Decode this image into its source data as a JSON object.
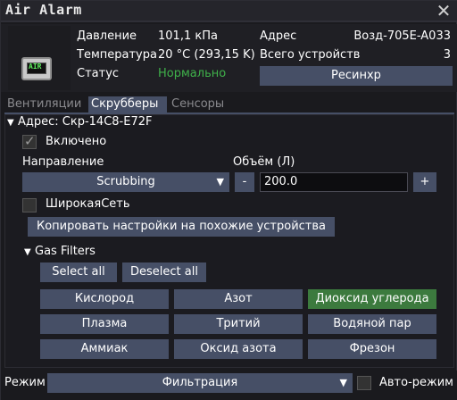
{
  "window": {
    "title": "Air Alarm"
  },
  "header": {
    "pressure_label": "Давление",
    "pressure_value": "101,1 кПа",
    "temperature_label": "Температура",
    "temperature_value": "20 °C (293,15 K)",
    "status_label": "Статус",
    "status_value": "Нормально",
    "address_label": "Адрес",
    "address_value": "Возд-705E-A033",
    "devices_label": "Всего устройств",
    "devices_value": "3",
    "resync_label": "Ресинхр",
    "icon_text": "AIR",
    "status_color": "#3fb14a"
  },
  "tabs": [
    {
      "label": "Вентиляции",
      "active": false
    },
    {
      "label": "Скрубберы",
      "active": true
    },
    {
      "label": "Сенсоры",
      "active": false
    }
  ],
  "scrubber": {
    "address_label": "Адрес: Скр-14C8-E72F",
    "enabled_label": "Включено",
    "enabled": true,
    "direction_label": "Направление",
    "direction_value": "Scrubbing",
    "volume_label": "Объём (Л)",
    "volume_minus": "-",
    "volume_value": "200.0",
    "volume_plus": "+",
    "widenet_label": "ШирокаяСеть",
    "widenet": false,
    "copy_label": "Копировать настройки на похожие устройства",
    "gas_filters_label": "Gas Filters",
    "select_all": "Select all",
    "deselect_all": "Deselect all",
    "gases": [
      {
        "label": "Кислород",
        "active": false
      },
      {
        "label": "Азот",
        "active": false
      },
      {
        "label": "Диоксид углерода",
        "active": true
      },
      {
        "label": "Плазма",
        "active": false
      },
      {
        "label": "Тритий",
        "active": false
      },
      {
        "label": "Водяной пар",
        "active": false
      },
      {
        "label": "Аммиак",
        "active": false
      },
      {
        "label": "Оксид азота",
        "active": false
      },
      {
        "label": "Фрезон",
        "active": false
      }
    ]
  },
  "footer": {
    "mode_label": "Режим",
    "mode_value": "Фильтрация",
    "auto_label": "Авто-режим",
    "auto": false
  },
  "colors": {
    "button": "#464f66",
    "active_gas": "#3c7a3e",
    "ok_text": "#3fb14a"
  },
  "icons": {
    "close": "close-icon",
    "caret": "caret-down-icon",
    "collapse": "triangle-down-icon",
    "check": "check-icon"
  }
}
